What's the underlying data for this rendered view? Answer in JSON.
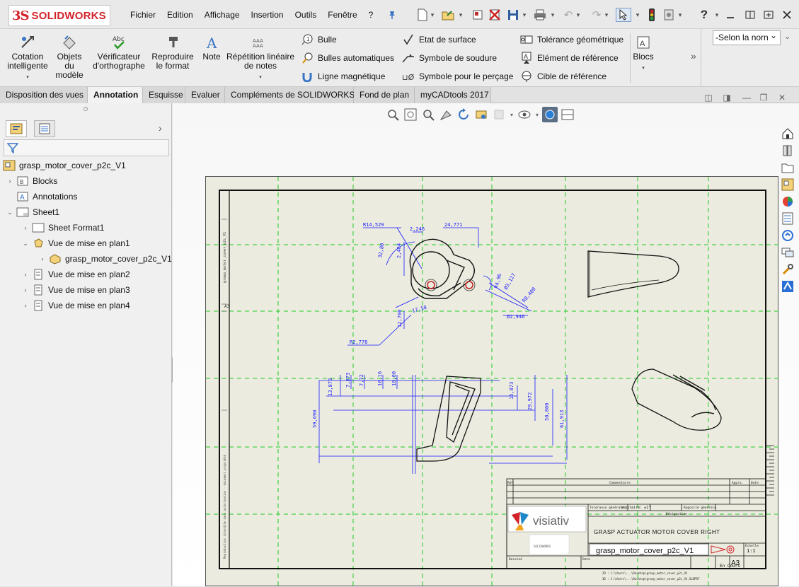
{
  "app": {
    "brand_prefix": "3S",
    "brand_name": "SOLIDWORKS",
    "menus": [
      "Fichier",
      "Edition",
      "Affichage",
      "Insertion",
      "Outils",
      "Fenêtre",
      "?"
    ],
    "help_glyph": "?",
    "accent_color": "#d2232a"
  },
  "ribbon": {
    "big_buttons": [
      {
        "label1": "Cotation",
        "label2": "intelligente",
        "label3": "",
        "icon": "smart-dimension-icon"
      },
      {
        "label1": "Objets",
        "label2": "du",
        "label3": "modèle",
        "icon": "model-items-icon"
      },
      {
        "label1": "Vérificateur",
        "label2": "d'orthographe",
        "label3": "",
        "icon": "spell-checker-icon"
      },
      {
        "label1": "Reproduire",
        "label2": "le format",
        "label3": "",
        "icon": "format-painter-icon"
      },
      {
        "label1": "Note",
        "label2": "",
        "label3": "",
        "icon": "note-icon"
      },
      {
        "label1": "Répétition linéaire",
        "label2": "de notes",
        "label3": "",
        "icon": "linear-note-pattern-icon"
      }
    ],
    "small_col1": [
      "Bulle",
      "Bulles automatiques",
      "Ligne magnétique"
    ],
    "small_col2": [
      "Etat de surface",
      "Symbole de soudure",
      "Symbole pour le perçage"
    ],
    "small_col3": [
      "Tolérance géométrique",
      "Elément de référence",
      "Cible de référence"
    ],
    "blocs": "Blocs",
    "more": "»",
    "layer_select": "-Selon la norn"
  },
  "tabs": [
    "Disposition des vues",
    "Annotation",
    "Esquisse",
    "Evaluer",
    "Compléments de SOLIDWORKS",
    "Fond de plan",
    "myCADtools 2017"
  ],
  "active_tab": "Annotation",
  "tree": {
    "root": "grasp_motor_cover_p2c_V1",
    "items": [
      {
        "label": "Blocks",
        "level": 1,
        "expander": "›"
      },
      {
        "label": "Annotations",
        "level": 1,
        "expander": ""
      },
      {
        "label": "Sheet1",
        "level": 1,
        "expander": "⌄"
      },
      {
        "label": "Sheet Format1",
        "level": 2,
        "expander": "›"
      },
      {
        "label": "Vue de mise en plan1",
        "level": 2,
        "expander": "⌄"
      },
      {
        "label": "grasp_motor_cover_p2c_V1",
        "level": 3,
        "expander": "›"
      },
      {
        "label": "Vue de mise en plan2",
        "level": 2,
        "expander": "›"
      },
      {
        "label": "Vue de mise en plan3",
        "level": 2,
        "expander": "›"
      },
      {
        "label": "Vue de mise en plan4",
        "level": 2,
        "expander": "›"
      }
    ]
  },
  "drawing": {
    "dims_top": [
      "R14,529",
      "2,246",
      "24,771",
      "32,80",
      "2,404",
      "R4,96",
      "Ø3,127",
      "R0,400",
      "Ø2,946",
      "17,50",
      "12,700",
      "R2,778"
    ],
    "dims_bottom": [
      "13,873",
      "7,873",
      "7,72",
      "10,16",
      "10,00",
      "15,873",
      "29,972",
      "59,690",
      "50,800",
      "61,913"
    ],
    "title_block": {
      "commentaire": "Commentaire",
      "appro": "Appro.",
      "date": "Date",
      "ref": "Réf",
      "tolerance": "Tolérance générale",
      "angulaire": "angulaire: ±1°",
      "rugosite": "Rugosité générale",
      "designation_label": "Désignation",
      "designation": "GRASP ACTUATOR MOTOR COVER RIGHT",
      "company": "visiativ",
      "sub_logo": "SOLIDWORKS",
      "filename": "grasp_motor_cover_p2c_V1",
      "echelle_label": "Échelle",
      "echelle": "1:1",
      "format": "A3",
      "etat": "En Cours",
      "dessine": "Dessiné",
      "date_label": "Date",
      "path1": "2D : C:\\Users\\...\\Desktop\\grasp_motor_cover_p2c_V1",
      "path2": "3D : C:\\Users\\...\\Desktop\\grasp_motor_cover_p2c_V1.SLDPRT"
    }
  }
}
